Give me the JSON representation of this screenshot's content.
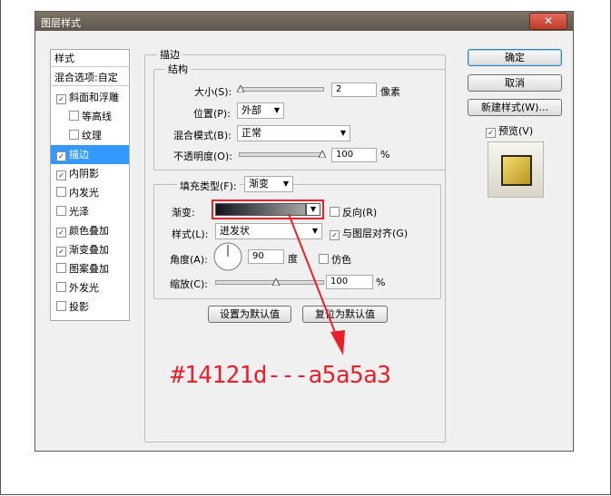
{
  "window": {
    "title": "图层样式",
    "close_icon": "close-icon"
  },
  "sidebar": {
    "header": "样式",
    "blend_options": "混合选项:自定",
    "items": [
      {
        "label": "斜面和浮雕",
        "checked": true
      },
      {
        "label": "等高线",
        "checked": false
      },
      {
        "label": "纹理",
        "checked": false
      },
      {
        "label": "描边",
        "checked": true,
        "selected": true
      },
      {
        "label": "内阴影",
        "checked": true
      },
      {
        "label": "内发光",
        "checked": false
      },
      {
        "label": "光泽",
        "checked": false
      },
      {
        "label": "颜色叠加",
        "checked": true
      },
      {
        "label": "渐变叠加",
        "checked": true
      },
      {
        "label": "图案叠加",
        "checked": false
      },
      {
        "label": "外发光",
        "checked": false
      },
      {
        "label": "投影",
        "checked": false
      }
    ]
  },
  "stroke": {
    "group_title": "描边",
    "structure_title": "结构",
    "size_label": "大小(S):",
    "size_value": "2",
    "size_unit": "像素",
    "position_label": "位置(P):",
    "position_value": "外部",
    "blend_label": "混合模式(B):",
    "blend_value": "正常",
    "opacity_label": "不透明度(O):",
    "opacity_value": "100",
    "percent": "%",
    "fill_type_label": "填充类型(F):",
    "fill_type_value": "渐变",
    "gradient_label": "渐变:",
    "reverse_label": "反向(R)",
    "style_label": "样式(L):",
    "style_value": "迸发状",
    "align_label": "与图层对齐(G)",
    "angle_label": "角度(A):",
    "angle_value": "90",
    "angle_unit": "度",
    "dither_label": "仿色",
    "scale_label": "缩放(C):",
    "scale_value": "100",
    "scale_percent": "%",
    "set_default": "设置为默认值",
    "reset_default": "复位为默认值"
  },
  "buttons": {
    "ok": "确定",
    "cancel": "取消",
    "new_style": "新建样式(W)...",
    "preview": "预览(V)"
  },
  "annotation": {
    "text": "#14121d---a5a5a3",
    "color": "#e8202a"
  },
  "gradient": {
    "start": "#14121d",
    "end": "#a5a5a3"
  },
  "preview_swatch_color": "#d4b83a"
}
